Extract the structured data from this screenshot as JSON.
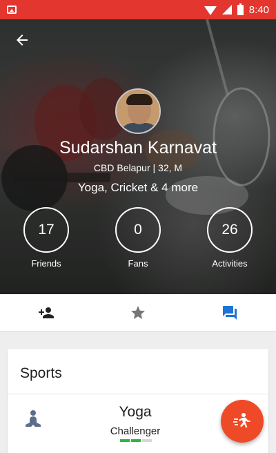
{
  "status_bar": {
    "time": "8:40",
    "icons": [
      "image-icon",
      "wifi-icon",
      "signal-icon",
      "battery-icon"
    ]
  },
  "profile": {
    "name": "Sudarshan Karnavat",
    "location": "CBD Belapur | 32, M",
    "interests": "Yoga, Cricket & 4 more"
  },
  "stats": [
    {
      "value": "17",
      "label": "Friends"
    },
    {
      "value": "0",
      "label": "Fans"
    },
    {
      "value": "26",
      "label": "Activities"
    }
  ],
  "tabs": [
    {
      "icon": "add-friend-icon",
      "selected": false
    },
    {
      "icon": "star-icon",
      "selected": false
    },
    {
      "icon": "chat-icon",
      "selected": true
    }
  ],
  "sports_card": {
    "title": "Sports",
    "items": [
      {
        "icon": "yoga-icon",
        "name": "Yoga",
        "level": "Challenger",
        "level_progress": 0.67
      }
    ]
  },
  "fab": {
    "icon": "running-person-icon"
  },
  "colors": {
    "status_bar": "#e3362f",
    "accent_blue": "#1e74d6",
    "fab": "#ef4a28",
    "level_green": "#2db742"
  }
}
